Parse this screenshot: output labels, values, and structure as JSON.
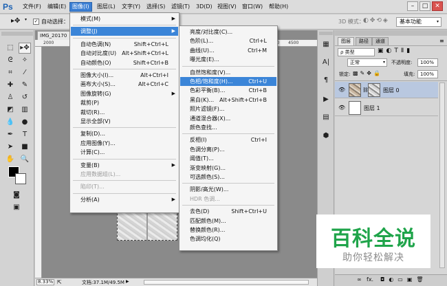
{
  "app": {
    "logo": "Ps"
  },
  "menubar": {
    "items": [
      "文件(F)",
      "编辑(E)",
      "图像(I)",
      "图层(L)",
      "文字(Y)",
      "选择(S)",
      "滤镜(T)",
      "3D(D)",
      "视图(V)",
      "窗口(W)",
      "帮助(H)"
    ],
    "active_index": 2
  },
  "window_controls": {
    "minimize": "–",
    "maximize": "□",
    "close": "✕"
  },
  "options_bar": {
    "auto_select_label": "自动选择：",
    "mode_3d_label": "3D 模式：",
    "workspace": "基本功能"
  },
  "document": {
    "tab_title": "IMG_20170",
    "ruler_ticks": [
      "2000",
      "3000",
      "4000",
      "4500"
    ],
    "zoom": "8.33%",
    "doc_size": "文档:37.1M/49.5M"
  },
  "image_menu": {
    "items": [
      {
        "label": "模式(M)",
        "shortcut": "",
        "submenu": true
      },
      {
        "sep": true
      },
      {
        "label": "调整(J)",
        "shortcut": "",
        "submenu": true,
        "highlight": true
      },
      {
        "sep": true
      },
      {
        "label": "自动色调(N)",
        "shortcut": "Shift+Ctrl+L"
      },
      {
        "label": "自动对比度(U)",
        "shortcut": "Alt+Shift+Ctrl+L"
      },
      {
        "label": "自动颜色(O)",
        "shortcut": "Shift+Ctrl+B"
      },
      {
        "sep": true
      },
      {
        "label": "图像大小(I)...",
        "shortcut": "Alt+Ctrl+I"
      },
      {
        "label": "画布大小(S)...",
        "shortcut": "Alt+Ctrl+C"
      },
      {
        "label": "图像旋转(G)",
        "shortcut": "",
        "submenu": true
      },
      {
        "label": "裁剪(P)",
        "shortcut": ""
      },
      {
        "label": "裁切(R)...",
        "shortcut": ""
      },
      {
        "label": "显示全部(V)",
        "shortcut": ""
      },
      {
        "sep": true
      },
      {
        "label": "复制(D)...",
        "shortcut": ""
      },
      {
        "label": "应用图像(Y)...",
        "shortcut": ""
      },
      {
        "label": "计算(C)...",
        "shortcut": ""
      },
      {
        "sep": true
      },
      {
        "label": "变量(B)",
        "shortcut": "",
        "submenu": true
      },
      {
        "label": "应用数据组(L)...",
        "shortcut": "",
        "disabled": true
      },
      {
        "sep": true
      },
      {
        "label": "陷印(T)...",
        "shortcut": "",
        "disabled": true
      },
      {
        "sep": true
      },
      {
        "label": "分析(A)",
        "shortcut": "",
        "submenu": true
      }
    ]
  },
  "adjust_menu": {
    "items": [
      {
        "label": "亮度/对比度(C)...",
        "shortcut": ""
      },
      {
        "label": "色阶(L)...",
        "shortcut": "Ctrl+L"
      },
      {
        "label": "曲线(U)...",
        "shortcut": "Ctrl+M"
      },
      {
        "label": "曝光度(E)...",
        "shortcut": ""
      },
      {
        "sep": true
      },
      {
        "label": "自然饱和度(V)...",
        "shortcut": ""
      },
      {
        "label": "色相/饱和度(H)...",
        "shortcut": "Ctrl+U",
        "highlight": true
      },
      {
        "label": "色彩平衡(B)...",
        "shortcut": "Ctrl+B"
      },
      {
        "label": "黑白(K)...",
        "shortcut": "Alt+Shift+Ctrl+B"
      },
      {
        "label": "照片滤镜(F)...",
        "shortcut": ""
      },
      {
        "label": "通道混合器(X)...",
        "shortcut": ""
      },
      {
        "label": "颜色查找...",
        "shortcut": ""
      },
      {
        "sep": true
      },
      {
        "label": "反相(I)",
        "shortcut": "Ctrl+I"
      },
      {
        "label": "色调分离(P)...",
        "shortcut": ""
      },
      {
        "label": "阈值(T)...",
        "shortcut": ""
      },
      {
        "label": "渐变映射(G)...",
        "shortcut": ""
      },
      {
        "label": "可选颜色(S)...",
        "shortcut": ""
      },
      {
        "sep": true
      },
      {
        "label": "阴影/高光(W)...",
        "shortcut": ""
      },
      {
        "label": "HDR 色调...",
        "shortcut": "",
        "disabled": true
      },
      {
        "sep": true
      },
      {
        "label": "去色(D)",
        "shortcut": "Shift+Ctrl+U"
      },
      {
        "label": "匹配颜色(M)...",
        "shortcut": ""
      },
      {
        "label": "替换颜色(R)...",
        "shortcut": ""
      },
      {
        "label": "色调均化(Q)",
        "shortcut": ""
      }
    ]
  },
  "layers_panel": {
    "tabs": [
      "图层",
      "路径",
      "通道"
    ],
    "filter_label": "ρ 类型",
    "blend_mode": "正常",
    "opacity_label": "不透明度:",
    "opacity_value": "100%",
    "lock_label": "锁定:",
    "fill_label": "填充:",
    "fill_value": "100%",
    "layers": [
      {
        "name": "图层 0",
        "selected": true
      },
      {
        "name": "图层 1",
        "selected": false
      }
    ],
    "bottom_icons": [
      "∞",
      "fx."
    ]
  },
  "watermark": {
    "title": "百科全说",
    "subtitle": "助你轻松解决"
  },
  "colors": {
    "menu_highlight": "#3b85d8",
    "watermark_green": "#1fa44a"
  }
}
